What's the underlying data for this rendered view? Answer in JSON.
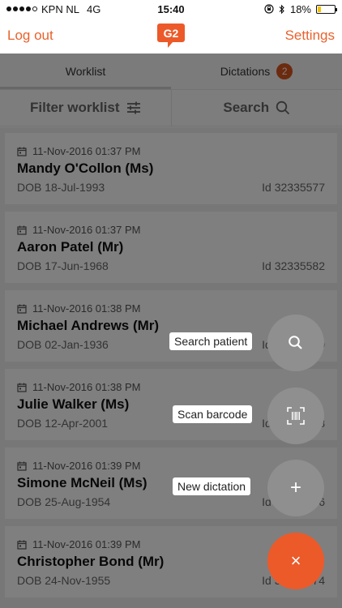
{
  "status_bar": {
    "carrier": "KPN NL",
    "network": "4G",
    "time": "15:40",
    "battery_percent": "18%",
    "battery_level": 0.18
  },
  "header": {
    "left_action": "Log out",
    "logo_text": "G2",
    "right_action": "Settings"
  },
  "tabs": [
    {
      "label": "Worklist",
      "active": true
    },
    {
      "label": "Dictations",
      "badge": "2"
    }
  ],
  "filter_bar": {
    "filter_label": "Filter worklist",
    "search_label": "Search"
  },
  "worklist": [
    {
      "date": "11-Nov-2016 01:37 PM",
      "name": "Mandy O'Collon (Ms)",
      "dob": "DOB 18-Jul-1993",
      "id": "Id 32335577"
    },
    {
      "date": "11-Nov-2016 01:37 PM",
      "name": "Aaron Patel (Mr)",
      "dob": "DOB 17-Jun-1968",
      "id": "Id 32335582"
    },
    {
      "date": "11-Nov-2016 01:38 PM",
      "name": "Michael Andrews (Mr)",
      "dob": "DOB 02-Jan-1936",
      "id": "Id 32335579"
    },
    {
      "date": "11-Nov-2016 01:38 PM",
      "name": "Julie Walker (Ms)",
      "dob": "DOB 12-Apr-2001",
      "id": "Id 32335578"
    },
    {
      "date": "11-Nov-2016 01:39 PM",
      "name": "Simone McNeil (Ms)",
      "dob": "DOB 25-Aug-1954",
      "id": "Id 32335576"
    },
    {
      "date": "11-Nov-2016 01:39 PM",
      "name": "Christopher Bond (Mr)",
      "dob": "DOB 24-Nov-1955",
      "id": "Id 32335574"
    }
  ],
  "fab_menu": {
    "search_patient": "Search patient",
    "scan_barcode": "Scan barcode",
    "new_dictation": "New dictation",
    "new_dictation_symbol": "+",
    "close_symbol": "×"
  },
  "colors": {
    "accent": "#e8622c",
    "badge": "#d9541c",
    "fab_gray": "#8f8f8f",
    "fab_orange": "#ec5a2a"
  }
}
